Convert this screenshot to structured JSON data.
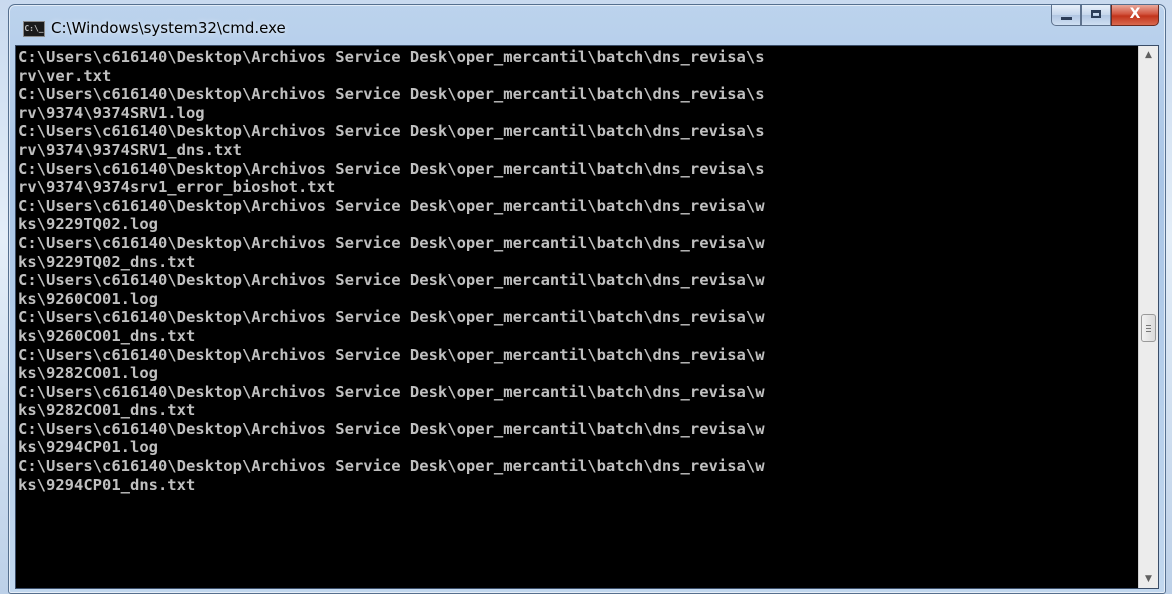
{
  "window": {
    "title": "C:\\Windows\\system32\\cmd.exe",
    "icon_label": "C:\\_"
  },
  "console": {
    "lines": [
      "C:\\Users\\c616140\\Desktop\\Archivos Service Desk\\oper_mercantil\\batch\\dns_revisa\\s",
      "rv\\ver.txt",
      "C:\\Users\\c616140\\Desktop\\Archivos Service Desk\\oper_mercantil\\batch\\dns_revisa\\s",
      "rv\\9374\\9374SRV1.log",
      "C:\\Users\\c616140\\Desktop\\Archivos Service Desk\\oper_mercantil\\batch\\dns_revisa\\s",
      "rv\\9374\\9374SRV1_dns.txt",
      "C:\\Users\\c616140\\Desktop\\Archivos Service Desk\\oper_mercantil\\batch\\dns_revisa\\s",
      "rv\\9374\\9374srv1_error_bioshot.txt",
      "C:\\Users\\c616140\\Desktop\\Archivos Service Desk\\oper_mercantil\\batch\\dns_revisa\\w",
      "ks\\9229TQ02.log",
      "C:\\Users\\c616140\\Desktop\\Archivos Service Desk\\oper_mercantil\\batch\\dns_revisa\\w",
      "ks\\9229TQ02_dns.txt",
      "C:\\Users\\c616140\\Desktop\\Archivos Service Desk\\oper_mercantil\\batch\\dns_revisa\\w",
      "ks\\9260CO01.log",
      "C:\\Users\\c616140\\Desktop\\Archivos Service Desk\\oper_mercantil\\batch\\dns_revisa\\w",
      "ks\\9260CO01_dns.txt",
      "C:\\Users\\c616140\\Desktop\\Archivos Service Desk\\oper_mercantil\\batch\\dns_revisa\\w",
      "ks\\9282CO01.log",
      "C:\\Users\\c616140\\Desktop\\Archivos Service Desk\\oper_mercantil\\batch\\dns_revisa\\w",
      "ks\\9282CO01_dns.txt",
      "C:\\Users\\c616140\\Desktop\\Archivos Service Desk\\oper_mercantil\\batch\\dns_revisa\\w",
      "ks\\9294CP01.log",
      "C:\\Users\\c616140\\Desktop\\Archivos Service Desk\\oper_mercantil\\batch\\dns_revisa\\w",
      "ks\\9294CP01_dns.txt"
    ]
  },
  "caption_buttons": {
    "close_glyph": "X"
  },
  "colors": {
    "console_background": "#000000",
    "console_text": "#c0c0c0",
    "close_button": "#c7432b",
    "titlebar": "#b3cbe8"
  },
  "icons": {
    "app": "cmd-prompt-icon",
    "minimize": "minimize-icon",
    "maximize": "maximize-icon",
    "close": "close-icon",
    "scroll_up": "chevron-up-icon",
    "scroll_down": "chevron-down-icon"
  }
}
